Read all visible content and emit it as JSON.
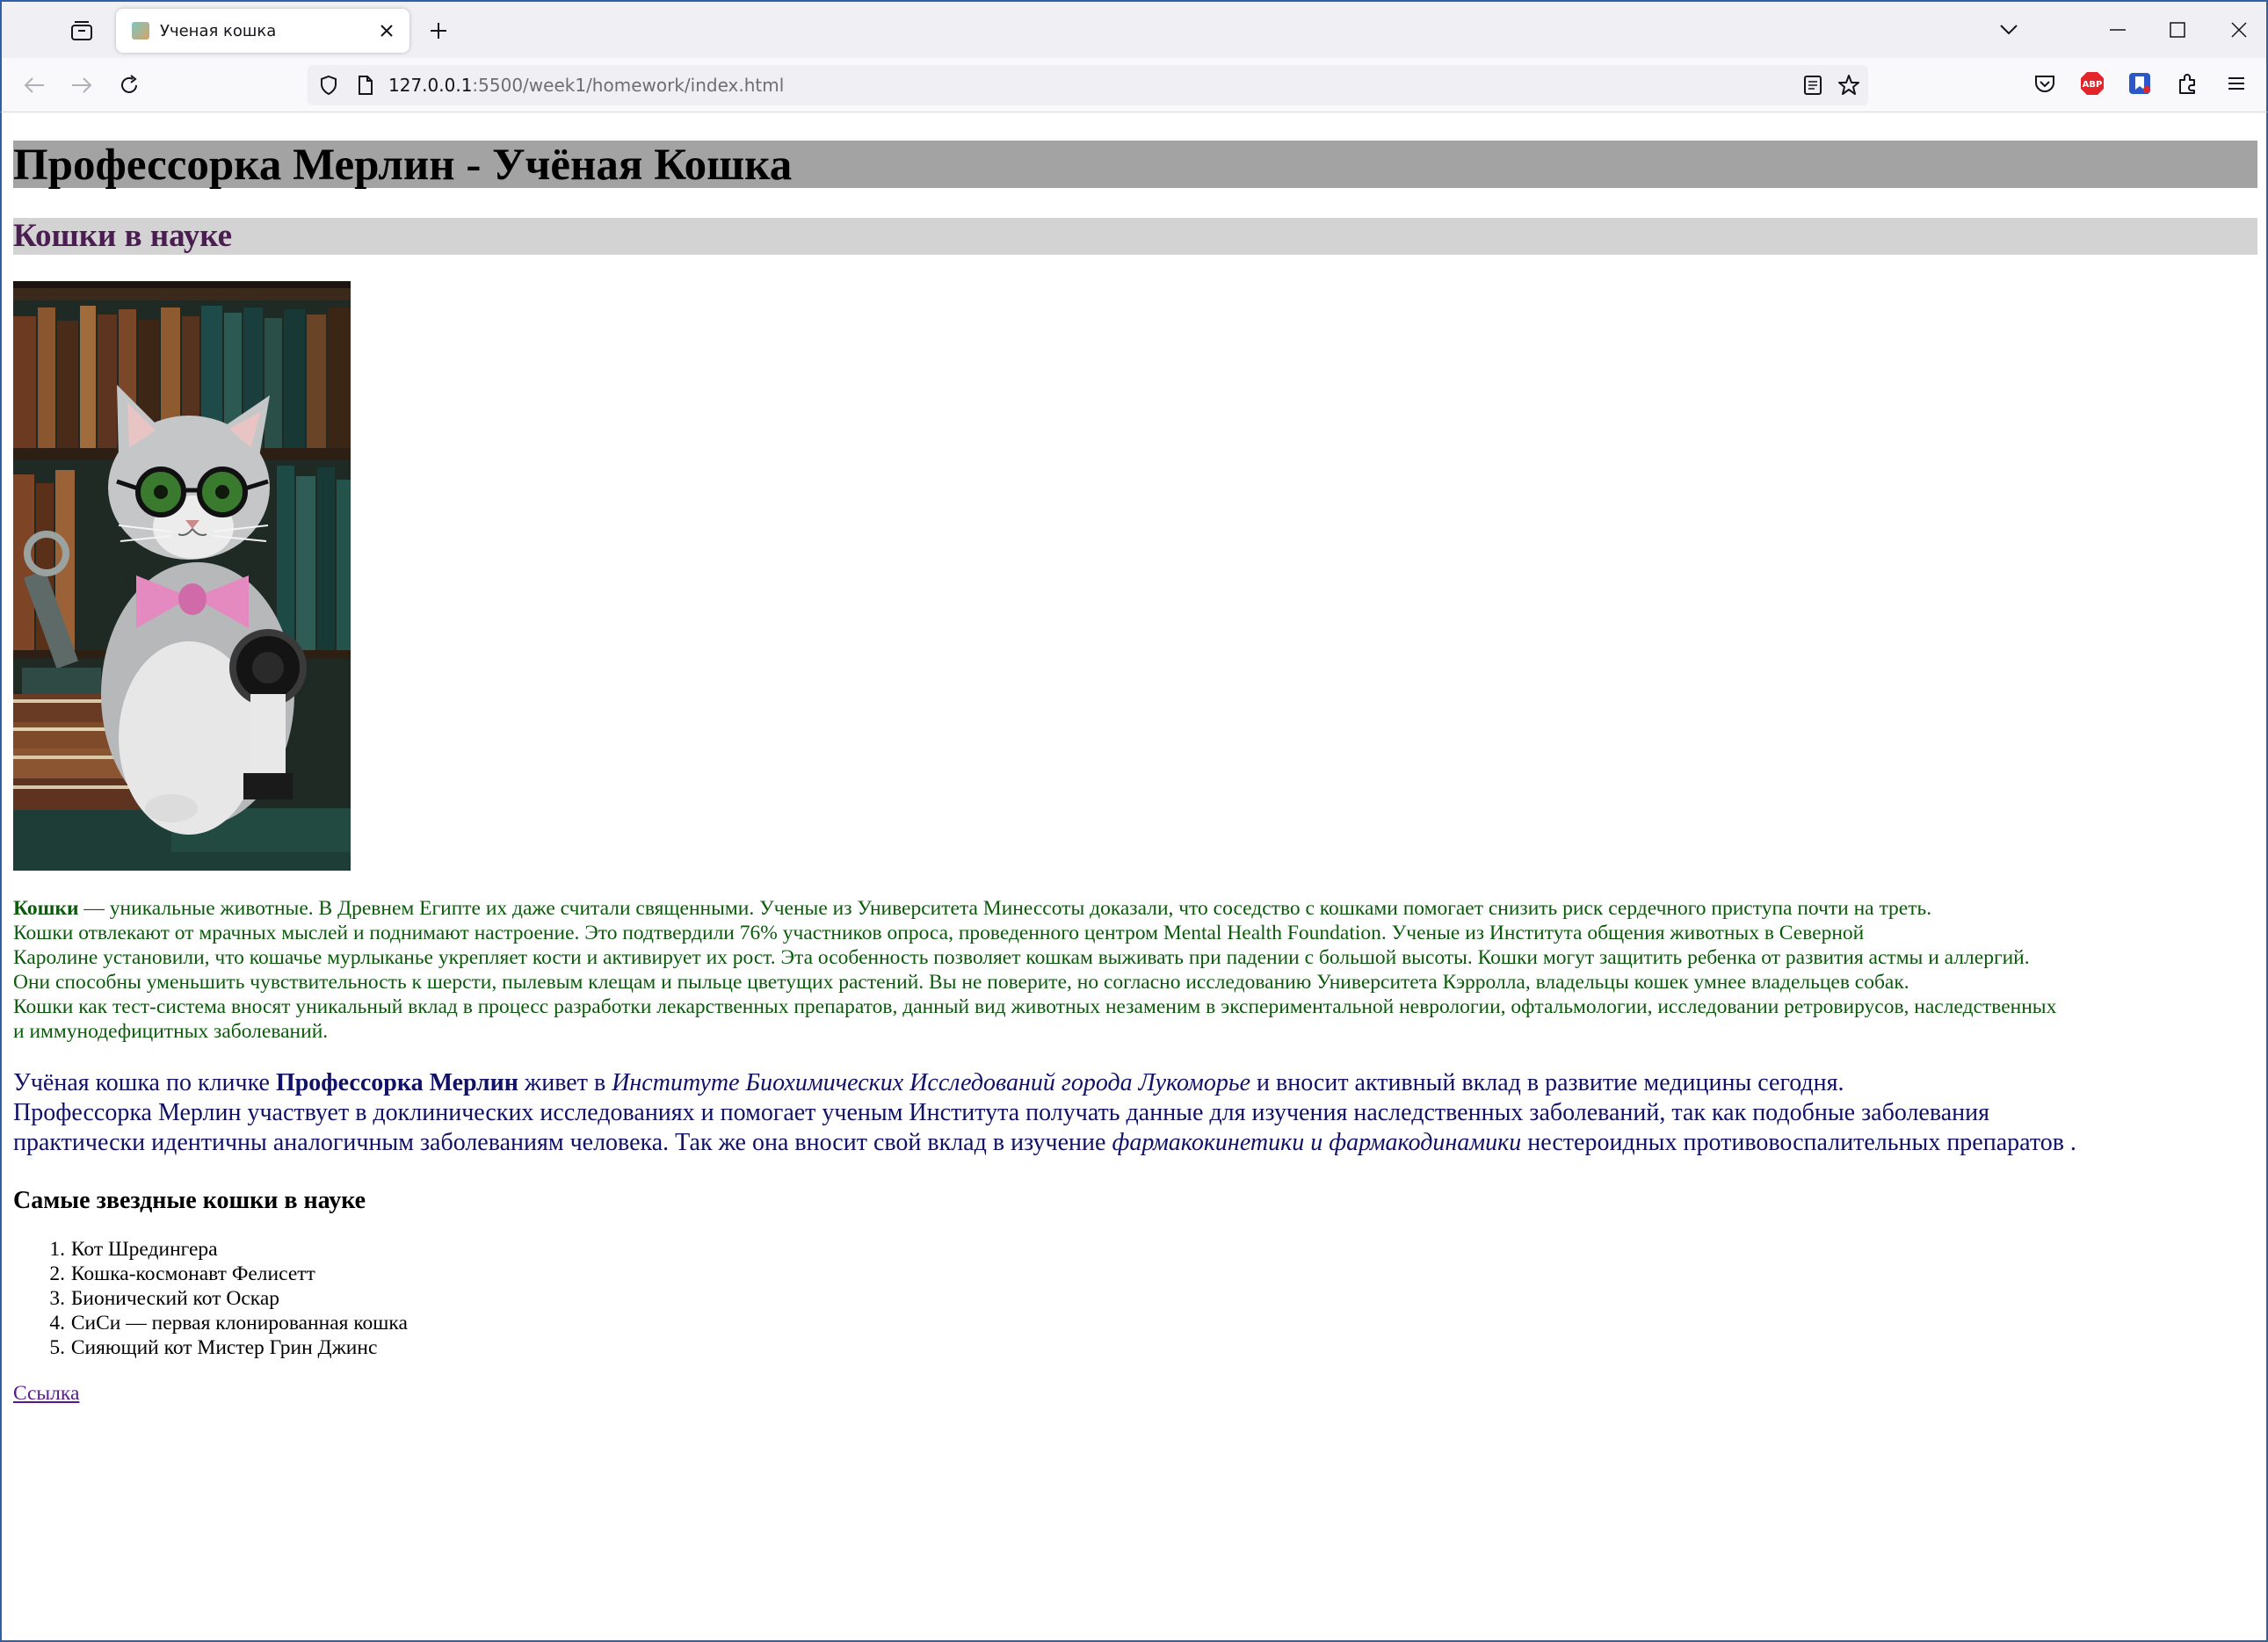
{
  "browser": {
    "tab_title": "Ученая кошка",
    "url_host": "127.0.0.1",
    "url_rest": ":5500/week1/homework/index.html",
    "abp_label": "ABP"
  },
  "page": {
    "h1": "Профессорка Мерлин - Учёная Кошка",
    "h2": "Кошки в науке",
    "intro": {
      "bold": "Кошки",
      "l1": " — уникальные животные. В Древнем Египте их даже считали священными. Ученые из Университета Минессоты доказали, что соседство с кошками помогает снизить риск сердечного приступа почти на треть.",
      "l2": "Кошки отвлекают от мрачных мыслей и поднимают настроение. Это подтвердили 76% участников опроса, проведенного центром Mental Health Foundation. Ученые из Института общения животных в Северной",
      "l3": "Каролине установили, что кошачье мурлыканье укрепляет кости и активирует их рост. Эта особенность позволяет кошкам выживать при падении с большой высоты. Кошки могут защитить ребенка от развития астмы и аллергий.",
      "l4": "Они способны уменьшить чувствительность к шерсти, пылевым клещам и пыльце цветущих растений. Вы не поверите, но согласно исследованию Университета Кэрролла, владельцы кошек умнее владельцев собак.",
      "l5": "Кошки как тест-система вносят уникальный вклад в процесс разработки лекарственных препаратов, данный вид животных незаменим в экспериментальной неврологии, офтальмологии, исследовании ретровирусов, наследственных",
      "l6": "и иммунодефицитных заболеваний."
    },
    "merlin": {
      "a1": "Учёная кошка по кличке ",
      "a_bold": "Профессорка Мерлин",
      "a2": " живет в ",
      "a_italic": "Институте Биохимических Исследований города Лукоморье",
      "a3": " и вносит активный вклад в развитие медицины сегодня.",
      "b1": "Профессорка Мерлин участвует в доклинических исследованиях и помогает ученым Института получать данные для изучения наследственных заболеваний, так как подобные заболевания",
      "c1": "практически идентичны аналогичным заболеваниям человека. Так же она вносит свой вклад в изучение ",
      "c_italic": "фармакокинетики и фармакодинамики",
      "c2": " нестероидных противовоспалительных препаратов ."
    },
    "h3": "Самые звездные кошки в науке",
    "list": [
      {
        "num": "1.",
        "text": "Кот Шредингера"
      },
      {
        "num": "2.",
        "text": "Кошка-космонавт Фелисетт"
      },
      {
        "num": "3.",
        "text": "Бионический кот Оскар"
      },
      {
        "num": "4.",
        "text": "СиСи — первая клонированная кошка"
      },
      {
        "num": "5.",
        "text": "Сияющий кот Мистер Грин Джинс"
      }
    ],
    "link": "Ссылка"
  }
}
